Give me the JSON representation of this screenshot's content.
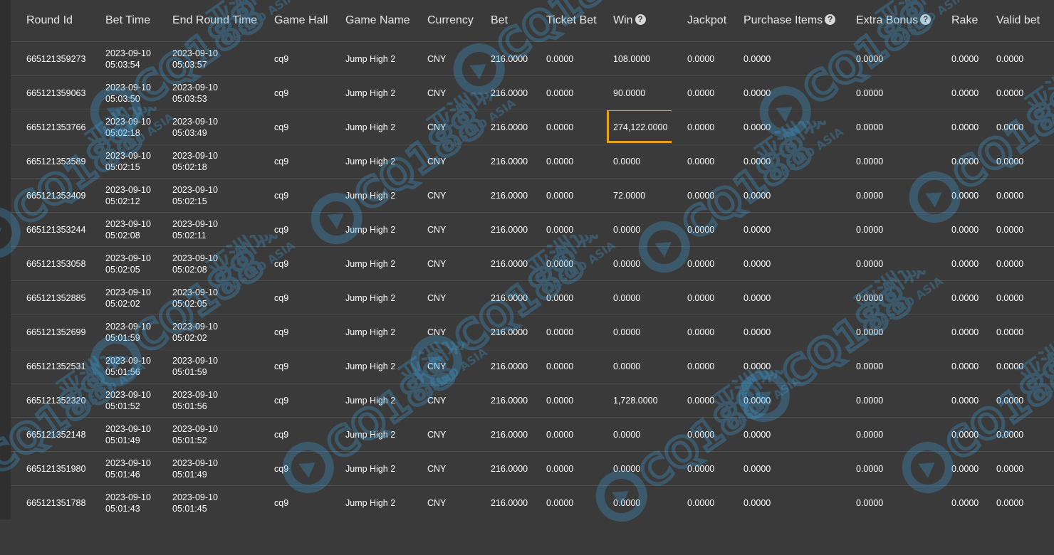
{
  "columns": [
    {
      "label": "Round Id",
      "help": false
    },
    {
      "label": "Bet Time",
      "help": false
    },
    {
      "label": "End Round Time",
      "help": false
    },
    {
      "label": "Game Hall",
      "help": false
    },
    {
      "label": "Game Name",
      "help": false
    },
    {
      "label": "Currency",
      "help": false
    },
    {
      "label": "Bet",
      "help": false
    },
    {
      "label": "Ticket Bet",
      "help": false
    },
    {
      "label": "Win",
      "help": true
    },
    {
      "label": "Jackpot",
      "help": false
    },
    {
      "label": "Purchase Items",
      "help": true
    },
    {
      "label": "Extra Bonus",
      "help": true
    },
    {
      "label": "Rake",
      "help": false
    },
    {
      "label": "Valid bet",
      "help": false
    }
  ],
  "help_glyph": "?",
  "highlight": {
    "row": 2,
    "column": "win",
    "color": "#e6a317"
  },
  "rows": [
    {
      "round_id": "665121359273",
      "bet_date": "2023-09-10",
      "bet_time": "05:03:54",
      "end_date": "2023-09-10",
      "end_time": "05:03:57",
      "game_hall": "cq9",
      "game_name": "Jump High 2",
      "currency": "CNY",
      "bet": "216.0000",
      "ticket_bet": "0.0000",
      "win": "108.0000",
      "jackpot": "0.0000",
      "purchase_items": "0.0000",
      "extra_bonus": "0.0000",
      "rake": "0.0000",
      "valid_bet": "0.0000"
    },
    {
      "round_id": "665121359063",
      "bet_date": "2023-09-10",
      "bet_time": "05:03:50",
      "end_date": "2023-09-10",
      "end_time": "05:03:53",
      "game_hall": "cq9",
      "game_name": "Jump High 2",
      "currency": "CNY",
      "bet": "216.0000",
      "ticket_bet": "0.0000",
      "win": "90.0000",
      "jackpot": "0.0000",
      "purchase_items": "0.0000",
      "extra_bonus": "0.0000",
      "rake": "0.0000",
      "valid_bet": "0.0000"
    },
    {
      "round_id": "665121353766",
      "bet_date": "2023-09-10",
      "bet_time": "05:02:18",
      "end_date": "2023-09-10",
      "end_time": "05:03:49",
      "game_hall": "cq9",
      "game_name": "Jump High 2",
      "currency": "CNY",
      "bet": "216.0000",
      "ticket_bet": "0.0000",
      "win": "274,122.0000",
      "jackpot": "0.0000",
      "purchase_items": "0.0000",
      "extra_bonus": "0.0000",
      "rake": "0.0000",
      "valid_bet": "0.0000"
    },
    {
      "round_id": "665121353589",
      "bet_date": "2023-09-10",
      "bet_time": "05:02:15",
      "end_date": "2023-09-10",
      "end_time": "05:02:18",
      "game_hall": "cq9",
      "game_name": "Jump High 2",
      "currency": "CNY",
      "bet": "216.0000",
      "ticket_bet": "0.0000",
      "win": "0.0000",
      "jackpot": "0.0000",
      "purchase_items": "0.0000",
      "extra_bonus": "0.0000",
      "rake": "0.0000",
      "valid_bet": "0.0000"
    },
    {
      "round_id": "665121353409",
      "bet_date": "2023-09-10",
      "bet_time": "05:02:12",
      "end_date": "2023-09-10",
      "end_time": "05:02:15",
      "game_hall": "cq9",
      "game_name": "Jump High 2",
      "currency": "CNY",
      "bet": "216.0000",
      "ticket_bet": "0.0000",
      "win": "72.0000",
      "jackpot": "0.0000",
      "purchase_items": "0.0000",
      "extra_bonus": "0.0000",
      "rake": "0.0000",
      "valid_bet": "0.0000"
    },
    {
      "round_id": "665121353244",
      "bet_date": "2023-09-10",
      "bet_time": "05:02:08",
      "end_date": "2023-09-10",
      "end_time": "05:02:11",
      "game_hall": "cq9",
      "game_name": "Jump High 2",
      "currency": "CNY",
      "bet": "216.0000",
      "ticket_bet": "0.0000",
      "win": "0.0000",
      "jackpot": "0.0000",
      "purchase_items": "0.0000",
      "extra_bonus": "0.0000",
      "rake": "0.0000",
      "valid_bet": "0.0000"
    },
    {
      "round_id": "665121353058",
      "bet_date": "2023-09-10",
      "bet_time": "05:02:05",
      "end_date": "2023-09-10",
      "end_time": "05:02:08",
      "game_hall": "cq9",
      "game_name": "Jump High 2",
      "currency": "CNY",
      "bet": "216.0000",
      "ticket_bet": "0.0000",
      "win": "0.0000",
      "jackpot": "0.0000",
      "purchase_items": "0.0000",
      "extra_bonus": "0.0000",
      "rake": "0.0000",
      "valid_bet": "0.0000"
    },
    {
      "round_id": "665121352885",
      "bet_date": "2023-09-10",
      "bet_time": "05:02:02",
      "end_date": "2023-09-10",
      "end_time": "05:02:05",
      "game_hall": "cq9",
      "game_name": "Jump High 2",
      "currency": "CNY",
      "bet": "216.0000",
      "ticket_bet": "0.0000",
      "win": "0.0000",
      "jackpot": "0.0000",
      "purchase_items": "0.0000",
      "extra_bonus": "0.0000",
      "rake": "0.0000",
      "valid_bet": "0.0000"
    },
    {
      "round_id": "665121352699",
      "bet_date": "2023-09-10",
      "bet_time": "05:01:59",
      "end_date": "2023-09-10",
      "end_time": "05:02:02",
      "game_hall": "cq9",
      "game_name": "Jump High 2",
      "currency": "CNY",
      "bet": "216.0000",
      "ticket_bet": "0.0000",
      "win": "0.0000",
      "jackpot": "0.0000",
      "purchase_items": "0.0000",
      "extra_bonus": "0.0000",
      "rake": "0.0000",
      "valid_bet": "0.0000"
    },
    {
      "round_id": "665121352531",
      "bet_date": "2023-09-10",
      "bet_time": "05:01:56",
      "end_date": "2023-09-10",
      "end_time": "05:01:59",
      "game_hall": "cq9",
      "game_name": "Jump High 2",
      "currency": "CNY",
      "bet": "216.0000",
      "ticket_bet": "0.0000",
      "win": "0.0000",
      "jackpot": "0.0000",
      "purchase_items": "0.0000",
      "extra_bonus": "0.0000",
      "rake": "0.0000",
      "valid_bet": "0.0000"
    },
    {
      "round_id": "665121352320",
      "bet_date": "2023-09-10",
      "bet_time": "05:01:52",
      "end_date": "2023-09-10",
      "end_time": "05:01:56",
      "game_hall": "cq9",
      "game_name": "Jump High 2",
      "currency": "CNY",
      "bet": "216.0000",
      "ticket_bet": "0.0000",
      "win": "1,728.0000",
      "jackpot": "0.0000",
      "purchase_items": "0.0000",
      "extra_bonus": "0.0000",
      "rake": "0.0000",
      "valid_bet": "0.0000"
    },
    {
      "round_id": "665121352148",
      "bet_date": "2023-09-10",
      "bet_time": "05:01:49",
      "end_date": "2023-09-10",
      "end_time": "05:01:52",
      "game_hall": "cq9",
      "game_name": "Jump High 2",
      "currency": "CNY",
      "bet": "216.0000",
      "ticket_bet": "0.0000",
      "win": "0.0000",
      "jackpot": "0.0000",
      "purchase_items": "0.0000",
      "extra_bonus": "0.0000",
      "rake": "0.0000",
      "valid_bet": "0.0000"
    },
    {
      "round_id": "665121351980",
      "bet_date": "2023-09-10",
      "bet_time": "05:01:46",
      "end_date": "2023-09-10",
      "end_time": "05:01:49",
      "game_hall": "cq9",
      "game_name": "Jump High 2",
      "currency": "CNY",
      "bet": "216.0000",
      "ticket_bet": "0.0000",
      "win": "0.0000",
      "jackpot": "0.0000",
      "purchase_items": "0.0000",
      "extra_bonus": "0.0000",
      "rake": "0.0000",
      "valid_bet": "0.0000"
    },
    {
      "round_id": "665121351788",
      "bet_date": "2023-09-10",
      "bet_time": "05:01:43",
      "end_date": "2023-09-10",
      "end_time": "05:01:45",
      "game_hall": "cq9",
      "game_name": "Jump High 2",
      "currency": "CNY",
      "bet": "216.0000",
      "ticket_bet": "0.0000",
      "win": "0.0000",
      "jackpot": "0.0000",
      "purchase_items": "0.0000",
      "extra_bonus": "0.0000",
      "rake": "0.0000",
      "valid_bet": "0.0000"
    }
  ],
  "watermark": {
    "brand": "CQ188",
    "cn_text": "亚洲城",
    "en_text": "CASINO ASIA",
    "color": "#3fa9e8"
  }
}
